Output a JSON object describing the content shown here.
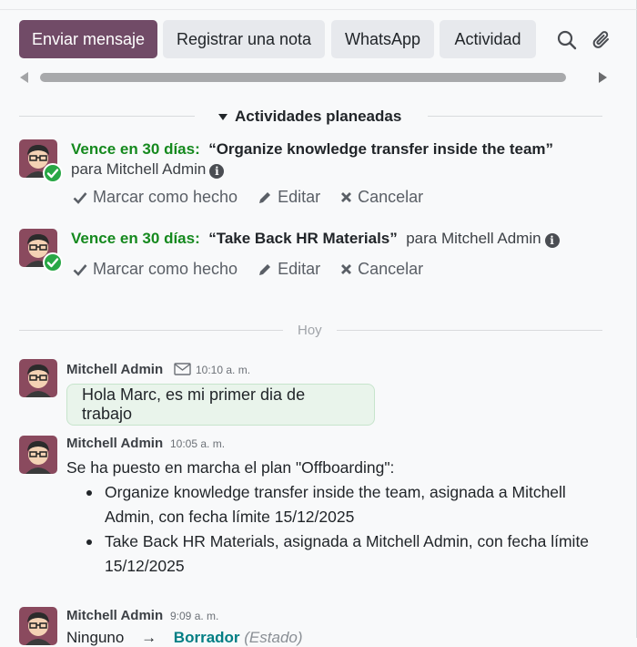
{
  "toolbar": {
    "send_message": "Enviar mensaje",
    "log_note": "Registrar una nota",
    "whatsapp": "WhatsApp",
    "activity": "Actividad",
    "search_icon": "search-icon",
    "attach_icon": "paperclip-icon"
  },
  "activities": {
    "section_title": "Actividades planeadas",
    "items": [
      {
        "due": "Vence en 30 días:",
        "title": "“Organize knowledge transfer inside the team”",
        "assignee": "para Mitchell Admin",
        "mark_done": "Marcar como hecho",
        "edit": "Editar",
        "cancel": "Cancelar"
      },
      {
        "due": "Vence en 30 días:",
        "title": "“Take Back HR Materials”",
        "assignee": "para Mitchell Admin",
        "mark_done": "Marcar como hecho",
        "edit": "Editar",
        "cancel": "Cancelar"
      }
    ]
  },
  "date_separator": "Hoy",
  "messages": [
    {
      "author": "Mitchell Admin",
      "time": "10:10 a. m.",
      "body": "Hola Marc, es mi primer dia de trabajo"
    },
    {
      "author": "Mitchell Admin",
      "time": "10:05 a. m.",
      "body": "Se ha puesto en marcha el plan \"Offboarding\":",
      "bullets": [
        "Organize knowledge transfer inside the team, asignada a Mitchell Admin, con fecha límite 15/12/2025",
        "Take Back HR Materials, asignada a Mitchell Admin, con fecha límite 15/12/2025"
      ]
    },
    {
      "author": "Mitchell Admin",
      "time": "9:09 a. m.",
      "from_stage": "Ninguno",
      "arrow": "→",
      "to_stage": "Borrador",
      "field": "(Estado)"
    }
  ],
  "colors": {
    "primary": "#714b67",
    "due_green": "#15891e",
    "check_green": "#28a745",
    "bubble_bg": "#e9f4eb",
    "teal": "#017e84"
  }
}
